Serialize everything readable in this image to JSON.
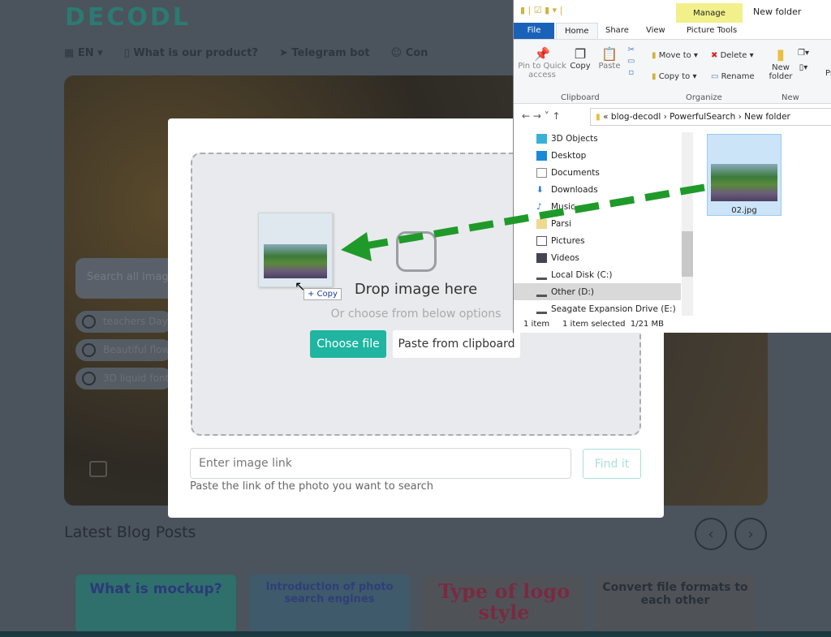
{
  "site": {
    "logo": "DECODL",
    "nav": [
      {
        "label": "EN",
        "icon": "uk-flag-icon"
      },
      {
        "label": "What is our product?",
        "icon": "product-icon"
      },
      {
        "label": "Telegram bot",
        "icon": "telegram-icon"
      },
      {
        "label": "Con",
        "icon": "contact-icon"
      }
    ],
    "search_placeholder": "Search all imag",
    "chips": [
      "teachers Day",
      "Beautiful flow",
      "3D liquid font"
    ],
    "blog_title": "Latest Blog Posts",
    "blog_cards": [
      "What is mockup?",
      "Introduction of photo search engines",
      "Type of logo style",
      "Convert file formats to each other"
    ]
  },
  "modal": {
    "drop_title": "Drop image here",
    "drop_sub": "Or choose from below options",
    "choose_file": "Choose file",
    "paste": "Paste from clipboard",
    "link_placeholder": "Enter image link",
    "find": "Find it",
    "helper": "Paste the link of the photo you want to search",
    "drag_badge": "+ Copy",
    "accent": "#1fb5a1"
  },
  "explorer": {
    "title": "New folder",
    "manage": "Manage",
    "tabs": [
      "File",
      "Home",
      "Share",
      "View",
      "Picture Tools"
    ],
    "ribbon": {
      "pin": "Pin to Quick access",
      "copy": "Copy",
      "paste": "Paste",
      "move_to": "Move to",
      "copy_to": "Copy to",
      "delete": "Delete",
      "rename": "Rename",
      "new_folder": "New folder",
      "clipboard": "Clipboard",
      "organize": "Organize",
      "new": "New",
      "pr": "Pr"
    },
    "path": [
      "«",
      "blog-decodl",
      "PowerfulSearch",
      "New folder"
    ],
    "tree": [
      "3D Objects",
      "Desktop",
      "Documents",
      "Downloads",
      "Music",
      "Parsi",
      "Pictures",
      "Videos",
      "Local Disk (C:)",
      "Other (D:)",
      "Seagate Expansion Drive (E:)"
    ],
    "selected_tree": "Other (D:)",
    "file": "02.jpg",
    "status_items": "1 item",
    "status_selected": "1 item selected  1/21 MB"
  }
}
